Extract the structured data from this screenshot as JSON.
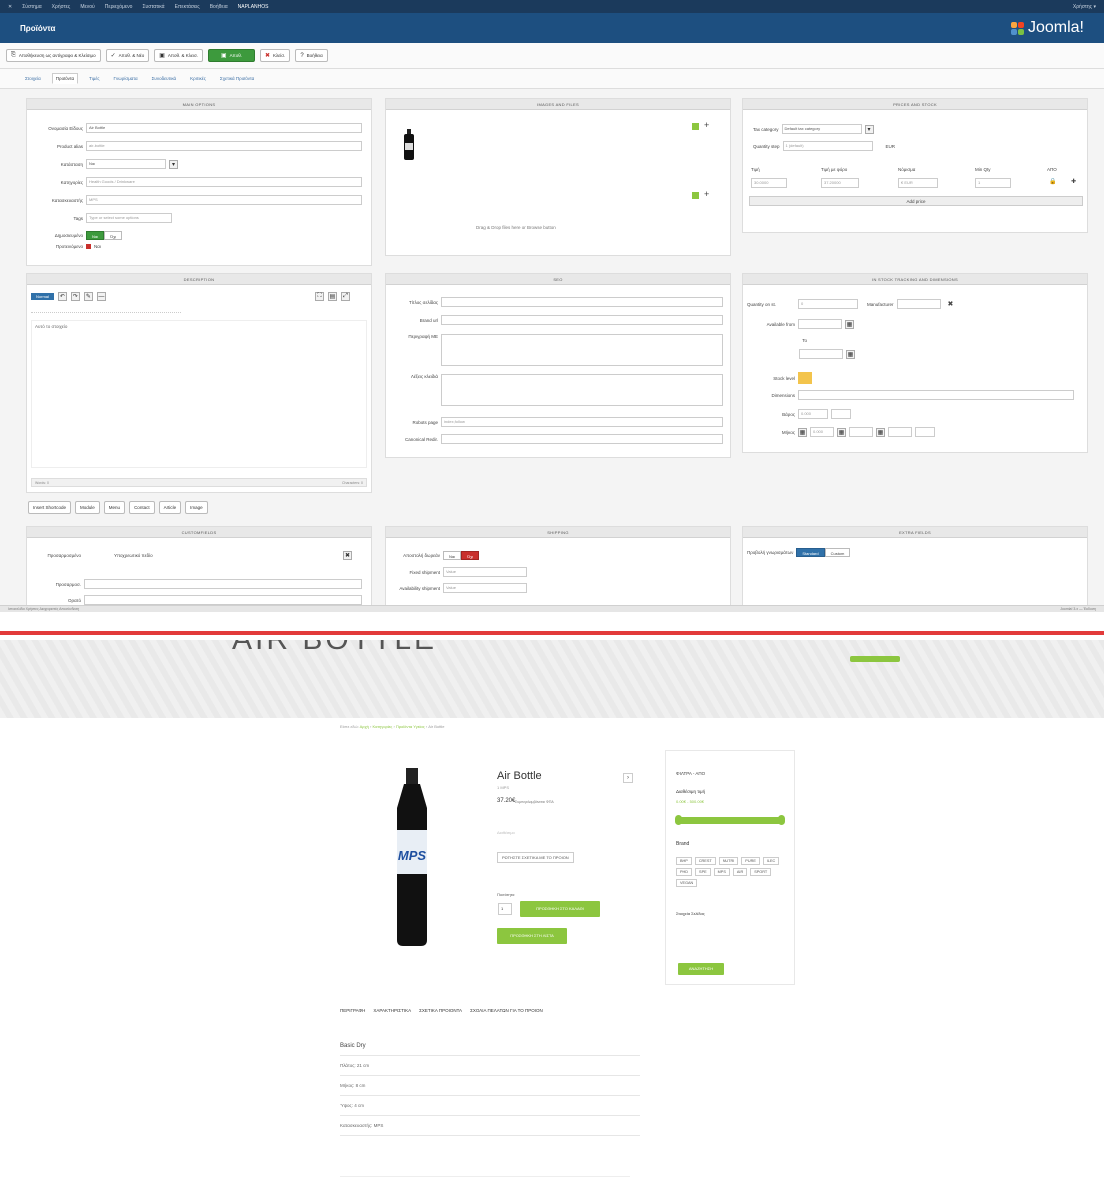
{
  "topbar": {
    "items": [
      "Σύστημα",
      "Χρήστες",
      "Μενού",
      "Περιεχόμενο",
      "Συστατικά",
      "Επεκτάσεις",
      "Βοήθεια",
      "NAPLANHOS"
    ],
    "right": "Χρήστης ▾"
  },
  "header": {
    "title": "Προϊόντα",
    "brand": "Joomla!"
  },
  "toolbar": {
    "buttons": [
      "Αποθήκευση ως αντίγραφο & Κλείσιμο",
      "Αποθ. & Νέο",
      "Αποθ. & Κλεισ.",
      "Αποθ.",
      "Κλείσ.",
      "Βοήθεια"
    ]
  },
  "tabs": [
    "Στοιχεία",
    "Προϊόντα",
    "Τιμές",
    "Γνωρίσματα",
    "Συνοδευτικά",
    "Κριτικές",
    "Σχετικά Προϊόντα"
  ],
  "main_options": {
    "title": "MAIN OPTIONS",
    "rows": [
      {
        "label": "Ονομασία Είδους",
        "value": "Air Bottle"
      },
      {
        "label": "Product alias",
        "value": "air-bottle"
      },
      {
        "label": "Κατάσταση",
        "value": "Ναι"
      },
      {
        "label": "Κατηγορίες",
        "value": "Health Goods / Drinkware"
      },
      {
        "label": "Κατασκευαστής",
        "value": "MPS"
      },
      {
        "label": "Tags",
        "value": "Type or select some options"
      },
      {
        "label": "Δημοσιευμένο",
        "value": ""
      },
      {
        "label": "Προτεινόμενο",
        "value": "Ναι"
      }
    ],
    "yes": "Ναι",
    "no": "Όχι"
  },
  "images": {
    "title": "IMAGES AND FILES",
    "drop_hint": "Drag & Drop files here or Browse button"
  },
  "prices": {
    "title": "PRICES AND STOCK",
    "tax_label": "Tax category",
    "tax_value": "Default tax category",
    "qty_label": "Quantity step",
    "qty_value": "1 (default)",
    "unit": "EUR",
    "cols": [
      "Τιμή",
      "Τιμή με φόρο",
      "Νόμισμα",
      "Min Qty",
      "ΑΠΟ"
    ],
    "vals": [
      "30.0000",
      "37.20000",
      "€ EUR",
      "1"
    ],
    "add": "Add price"
  },
  "description": {
    "title": "DESCRIPTION",
    "toolbar_label": "Normal",
    "body": "Αυτό το στοιχείο",
    "footer_left": "Words: 0",
    "footer_right": "Characters: 0",
    "buttons": [
      "Insert Shortcode",
      "Module",
      "Menu",
      "Contact",
      "Article",
      "Image"
    ]
  },
  "seo": {
    "title": "SEO",
    "rows": [
      {
        "label": "Τίτλος σελίδας",
        "value": ""
      },
      {
        "label": "Brand url",
        "value": ""
      },
      {
        "label": "Περιγραφή ΜΕ",
        "value": ""
      },
      {
        "label": "Λέξεις κλειδιά",
        "value": ""
      },
      {
        "label": "Robots page",
        "value": "index,follow"
      },
      {
        "label": "Canonical Redir.",
        "value": ""
      }
    ]
  },
  "stock": {
    "title": "IN STOCK TRACKING AND DIMENSIONS",
    "rows": [
      {
        "label": "Quantity on st.",
        "value": "0"
      },
      {
        "label": "Available from",
        "value": ""
      },
      {
        "label": "To",
        "value": ""
      },
      {
        "label": "Stock level",
        "value": ""
      },
      {
        "label": "Dimensions",
        "value": ""
      },
      {
        "label": "Βάρος",
        "value": "0.000"
      },
      {
        "label": "Μήκος",
        "value": "0.000"
      }
    ],
    "ship_label": "Manufacturer"
  },
  "customfields": {
    "title": "CUSTOMFIELDS",
    "rows": [
      {
        "label": "Προσαρμοσμένο",
        "value": "Υποχρεωτικό πεδίο"
      },
      {
        "label": "Προσαρμοσ.",
        "value": ""
      },
      {
        "label": "Ορατό",
        "value": ""
      }
    ]
  },
  "shipping": {
    "title": "SHIPPING",
    "rows": [
      {
        "label": "Αποστολή δωρεάν",
        "value": ""
      },
      {
        "label": "Fixed shipment",
        "value": "Value"
      },
      {
        "label": "Availability shipment",
        "value": "Value"
      }
    ],
    "no": "Όχι",
    "yes": "Ναι"
  },
  "extra": {
    "title": "EXTRA FIELDS",
    "label": "Προβολή γνωρισμάτων",
    "opt1": "Standard",
    "opt2": "Custom"
  },
  "statusbar": {
    "left": "Ιστοσελίδα   Χρήστες   Διαχειριστές   Αποσύνδεση",
    "right": "Joomla! 3.x — Έκδοση"
  },
  "store": {
    "hero": "AIR BOTTLE",
    "breadcrumb": [
      "Είστε εδώ:",
      "Αρχή",
      "Κατηγορίες",
      "Προϊόντα Υγείας",
      "Air Bottle"
    ],
    "product": {
      "name": "Air Bottle",
      "sku": "1 MPS",
      "price": "37.20€",
      "price_note": "Συμπεριλαμβάνεται ΦΠΑ",
      "stock": "Διαθέσιμο",
      "ask": "ΡΩΤΗΣΤΕ ΣΧΕΤΙΚΑ ΜΕ ΤΟ ΠΡΟΙΟΝ",
      "qty_label": "Ποσότητα",
      "qty": "1",
      "add_cart": "ΠΡΟΣΘΗΚΗ ΣΤΟ ΚΑΛΑΘΙ",
      "wishlist": "ΠΡΟΣΘΗΚΗ ΣΤΗ ΛΙΣΤΑ",
      "label_top": "MPS",
      "nav": "›"
    },
    "sidebar": {
      "title": "ΦΙΛΤΡΑ - ΑΠΟ",
      "range_label": "Διαθέσιμη τιμή",
      "range_value": "0.00€ - 500.00€",
      "brand_title": "Brand",
      "chips": [
        "BHP",
        "CREST",
        "NUTRI",
        "PURE",
        "ILEC",
        "PHD",
        "SPE",
        "MPS",
        "AIR",
        "SPORT",
        "VEGAN"
      ],
      "tags_title": "Στοιχεία Σελίδας",
      "apply": "ΑΝΑΖΗΤΗΣΗ"
    },
    "ptabs": [
      "ΠΕΡΙΓΡΑΦΗ",
      "ΧΑΡΑΚΤΗΡΙΣΤΙΚΑ",
      "ΣΧΕΤΙΚΑ ΠΡΟΙΟΝΤΑ",
      "ΣΧΟΛΙΑ ΠΕΛΑΤΩΝ ΓΙΑ ΤΟ ΠΡΟΙΟΝ"
    ],
    "specs": [
      "Basic Dry",
      "Πλάτος: 21 cm",
      "Μήκος: 8 cm",
      "Ύψος: 4 cm",
      "Κατασκευαστής: MPS"
    ]
  },
  "colors": {
    "admin_header": "#1d4f80",
    "accent_green": "#8cc63f",
    "save_green": "#3d9a3d",
    "red_line": "#e23a3a"
  }
}
